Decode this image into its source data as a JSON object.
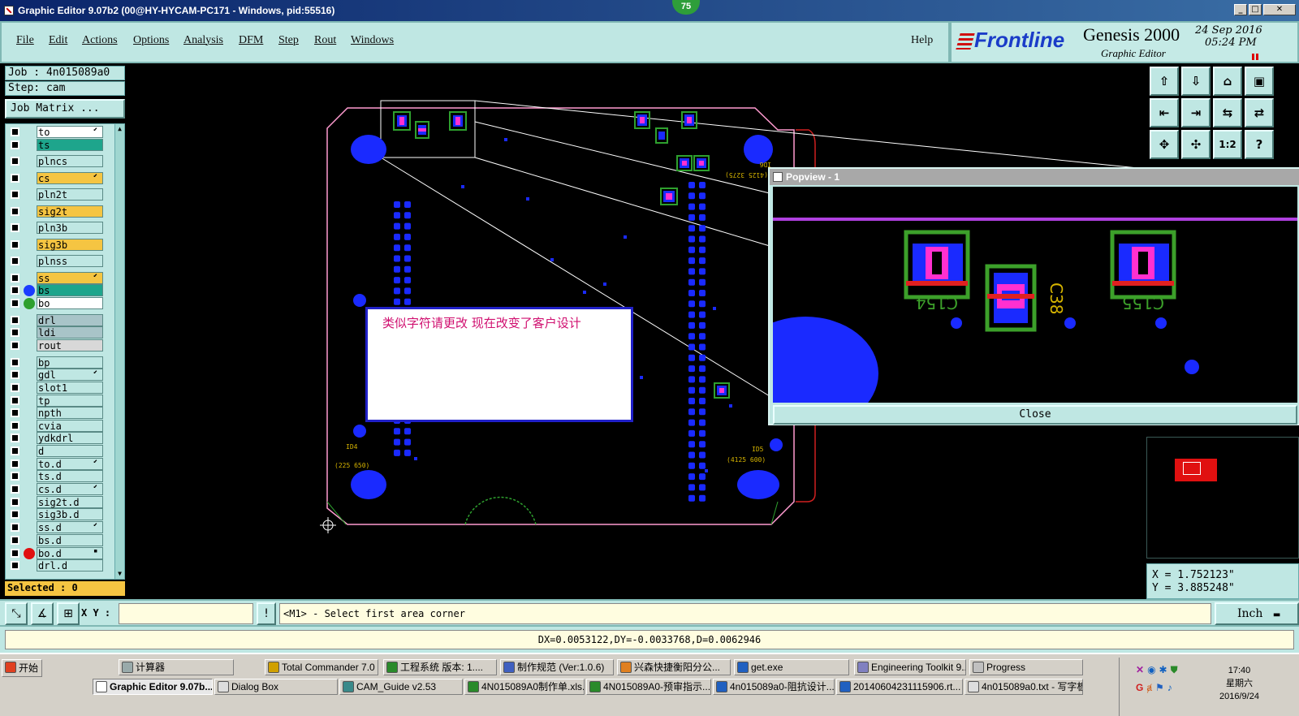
{
  "window": {
    "title": "Graphic Editor 9.07b2 (00@HY-HYCAM-PC171 - Windows, pid:55516)",
    "notif_badge": "75"
  },
  "menu": {
    "items": [
      "File",
      "Edit",
      "Actions",
      "Options",
      "Analysis",
      "DFM",
      "Step",
      "Rout",
      "Windows"
    ],
    "help": "Help"
  },
  "logo": {
    "brand": "Frontline",
    "product": "Genesis 2000",
    "subtitle": "Graphic Editor",
    "date": "24 Sep 2016",
    "time": "05:24 PM"
  },
  "job": {
    "job_line": "Job : 4n015089a0",
    "step_line": "Step: cam",
    "matrix_button": "Job Matrix ...",
    "selected": "Selected : 0"
  },
  "layers": [
    {
      "name": "to",
      "color": "#ffffff",
      "flag": "⬋"
    },
    {
      "name": "ts",
      "color": "#1ea58c",
      "flag": ""
    },
    {
      "name": "plncs",
      "color": "#bfe7e3",
      "flag": ""
    },
    {
      "name": "cs",
      "color": "#f5c542",
      "flag": "⬋"
    },
    {
      "name": "pln2t",
      "color": "#bfe7e3",
      "flag": ""
    },
    {
      "name": "sig2t",
      "color": "#f5c542",
      "flag": ""
    },
    {
      "name": "pln3b",
      "color": "#bfe7e3",
      "flag": ""
    },
    {
      "name": "sig3b",
      "color": "#f5c542",
      "flag": ""
    },
    {
      "name": "plnss",
      "color": "#bfe7e3",
      "flag": ""
    },
    {
      "name": "ss",
      "color": "#f5c542",
      "flag": "⬋"
    },
    {
      "name": "bs",
      "color": "#1ea58c",
      "flag": "",
      "dot": "#1a3cff"
    },
    {
      "name": "bo",
      "color": "#ffffff",
      "flag": "",
      "dot": "#2ea02e"
    },
    {
      "name": "drl",
      "color": "#a8c4c8",
      "flag": ""
    },
    {
      "name": "ldi",
      "color": "#a8c4c8",
      "flag": ""
    },
    {
      "name": "rout",
      "color": "#d8d8d8",
      "flag": ""
    },
    {
      "name": "bp",
      "color": "#bfe7e3",
      "flag": ""
    },
    {
      "name": "gdl",
      "color": "#bfe7e3",
      "flag": "⬋"
    },
    {
      "name": "slot1",
      "color": "#bfe7e3",
      "flag": ""
    },
    {
      "name": "tp",
      "color": "#bfe7e3",
      "flag": ""
    },
    {
      "name": "npth",
      "color": "#bfe7e3",
      "flag": ""
    },
    {
      "name": "cvia",
      "color": "#bfe7e3",
      "flag": ""
    },
    {
      "name": "ydkdrl",
      "color": "#bfe7e3",
      "flag": ""
    },
    {
      "name": "d",
      "color": "#bfe7e3",
      "flag": ""
    },
    {
      "name": "to.d",
      "color": "#bfe7e3",
      "flag": "⬋"
    },
    {
      "name": "ts.d",
      "color": "#bfe7e3",
      "flag": ""
    },
    {
      "name": "cs.d",
      "color": "#bfe7e3",
      "flag": "⬋"
    },
    {
      "name": "sig2t.d",
      "color": "#bfe7e3",
      "flag": ""
    },
    {
      "name": "sig3b.d",
      "color": "#bfe7e3",
      "flag": ""
    },
    {
      "name": "ss.d",
      "color": "#bfe7e3",
      "flag": "⬋"
    },
    {
      "name": "bs.d",
      "color": "#bfe7e3",
      "flag": ""
    },
    {
      "name": "bo.d",
      "color": "#bfe7e3",
      "flag": "▪",
      "dot": "#e01010"
    },
    {
      "name": "drl.d",
      "color": "#bfe7e3",
      "flag": ""
    }
  ],
  "tools": [
    [
      "⇧",
      "⇩",
      "⌂",
      "▣"
    ],
    [
      "⇤",
      "⇥",
      "⇆",
      "⇄"
    ],
    [
      "✥",
      "✣",
      "1:2",
      "?"
    ]
  ],
  "coords": {
    "x": "X = 1.752123\"",
    "y": "Y = 3.885248\""
  },
  "popview": {
    "title": "Popview - 1",
    "close": "Close"
  },
  "dialog": {
    "message": "类似字符请更改   现在改变了客户设计"
  },
  "command": {
    "xy_label": "X Y :",
    "xy_value": "",
    "prompt": "<M1> - Select first area corner",
    "units": "Inch"
  },
  "status": {
    "measure": "DX=0.0053122,DY=-0.0033768,D=0.0062946"
  },
  "taskbar": {
    "start": "开始",
    "row1": [
      "计算器",
      "Total Commander 7.0 ...",
      "工程系统  版本: 1....",
      "制作规范 (Ver:1.0.6)",
      "兴森快捷衡阳分公...",
      "get.exe",
      "Engineering Toolkit 9....",
      "Progress"
    ],
    "row2": [
      "Graphic Editor 9.07b...",
      "Dialog Box",
      "CAM_Guide v2.53",
      "4N015089A0制作单.xls...",
      "4N015089A0-预审指示...",
      "4n015089a0-阻抗设计...",
      "20140604231115906.rt...",
      "4n015089a0.txt - 写字板"
    ],
    "time": "17:40",
    "weekday": "星期六",
    "date": "2016/9/24"
  },
  "pcb_labels": {
    "id4": "ID4",
    "id5": "ID5",
    "id6": "ID6",
    "id4_coord": "(225 650)",
    "id5_coord": "(4125 600)",
    "id6_coord": "(4125 3275)"
  },
  "popview_labels": {
    "c154": "C154",
    "c38": "C38",
    "c155": "C155"
  },
  "colors": {
    "panel": "#bfe7e3",
    "pad_blue": "#1a2aff",
    "magenta": "#ff30d0",
    "green_outline": "#3ca02a",
    "silk_yellow": "#d6b400"
  }
}
